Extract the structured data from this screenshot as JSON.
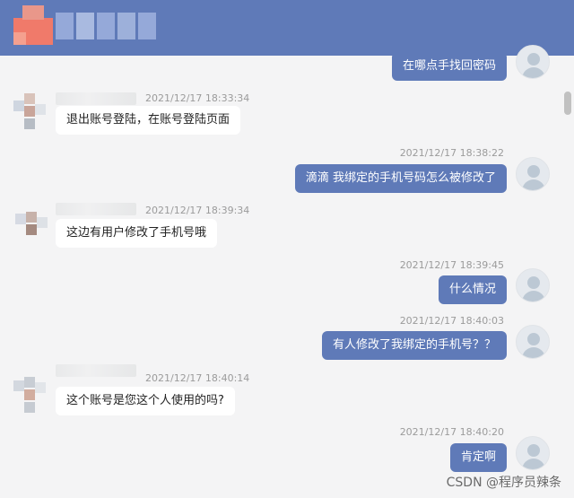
{
  "header": {
    "avatar": "pixelated-avatar",
    "name": "pixelated-name"
  },
  "messages": [
    {
      "dir": "out",
      "text": "在哪点手找回密码",
      "time": ""
    },
    {
      "dir": "in",
      "text": "退出账号登陆，在账号登陆页面",
      "time": "2021/12/17 18:33:34"
    },
    {
      "dir": "out",
      "text": "滴滴 我绑定的手机号码怎么被修改了",
      "time": "2021/12/17 18:38:22"
    },
    {
      "dir": "in",
      "text": "这边有用户修改了手机号哦",
      "time": "2021/12/17 18:39:34"
    },
    {
      "dir": "out",
      "text": "什么情况",
      "time": "2021/12/17 18:39:45"
    },
    {
      "dir": "out",
      "text": "有人修改了我绑定的手机号？？",
      "time": "2021/12/17 18:40:03"
    },
    {
      "dir": "in",
      "text": "这个账号是您这个人使用的吗?",
      "time": "2021/12/17 18:40:14"
    },
    {
      "dir": "out",
      "text": "肯定啊",
      "time": "2021/12/17 18:40:20"
    }
  ],
  "watermark": "CSDN @程序员辣条",
  "colors": {
    "header": "#5f7ab8",
    "bubble_out": "#5f7ab8",
    "bubble_in": "#ffffff",
    "background": "#f4f4f5"
  }
}
